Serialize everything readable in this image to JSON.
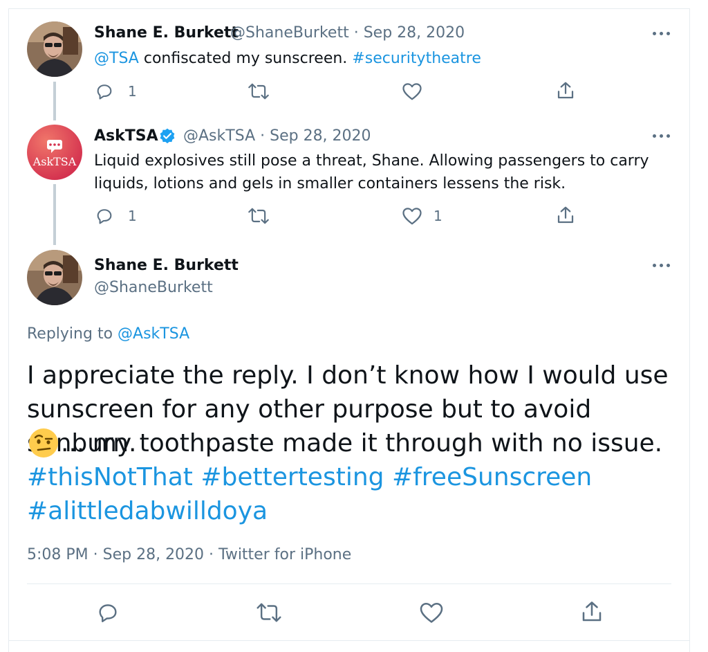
{
  "tweet1": {
    "name": "Shane E. Burkett",
    "handle": "@ShaneBurkett",
    "date": "Sep 28, 2020",
    "mention": "@TSA",
    "text": " confiscated my sunscreen. ",
    "hashtag": "#securitytheatre",
    "reply_count": "1"
  },
  "tweet2": {
    "name": "AskTSA",
    "handle": "@AskTSA",
    "date": "Sep 28, 2020",
    "avatar_text": "AskTSA",
    "line1": "Liquid explosives still pose a threat, Shane. Allowing passengers to carry",
    "line2": "liquids, lotions and gels in smaller containers lessens the risk.",
    "reply_count": "1",
    "like_count": "1"
  },
  "main_tweet": {
    "name": "Shane E. Burkett",
    "handle": "@ShaneBurkett",
    "replying_prefix": "Replying to ",
    "replying_handle": "@AskTSA",
    "line1": "I appreciate the reply. I don’t know how I would use",
    "line2": "sunscreen for any other purpose but to avoid sunburn.",
    "line3": "... my toothpaste made it through with no issue.",
    "hashtags_line1": "#thisNotThat #bettertesting #freeSunscreen",
    "hashtags_line2": "#alittledabwilldoya",
    "timestamp": "5:08 PM · Sep 28, 2020 · Twitter for iPhone"
  },
  "colors": {
    "link": "#1b95e0",
    "muted": "#5b7083",
    "verified": "#1da1f2",
    "asktsa_avatar": "#e0485a"
  },
  "icons": [
    "reply-icon",
    "retweet-icon",
    "like-icon",
    "share-icon",
    "more-icon",
    "verified-badge-icon",
    "raised-eyebrow-emoji"
  ]
}
